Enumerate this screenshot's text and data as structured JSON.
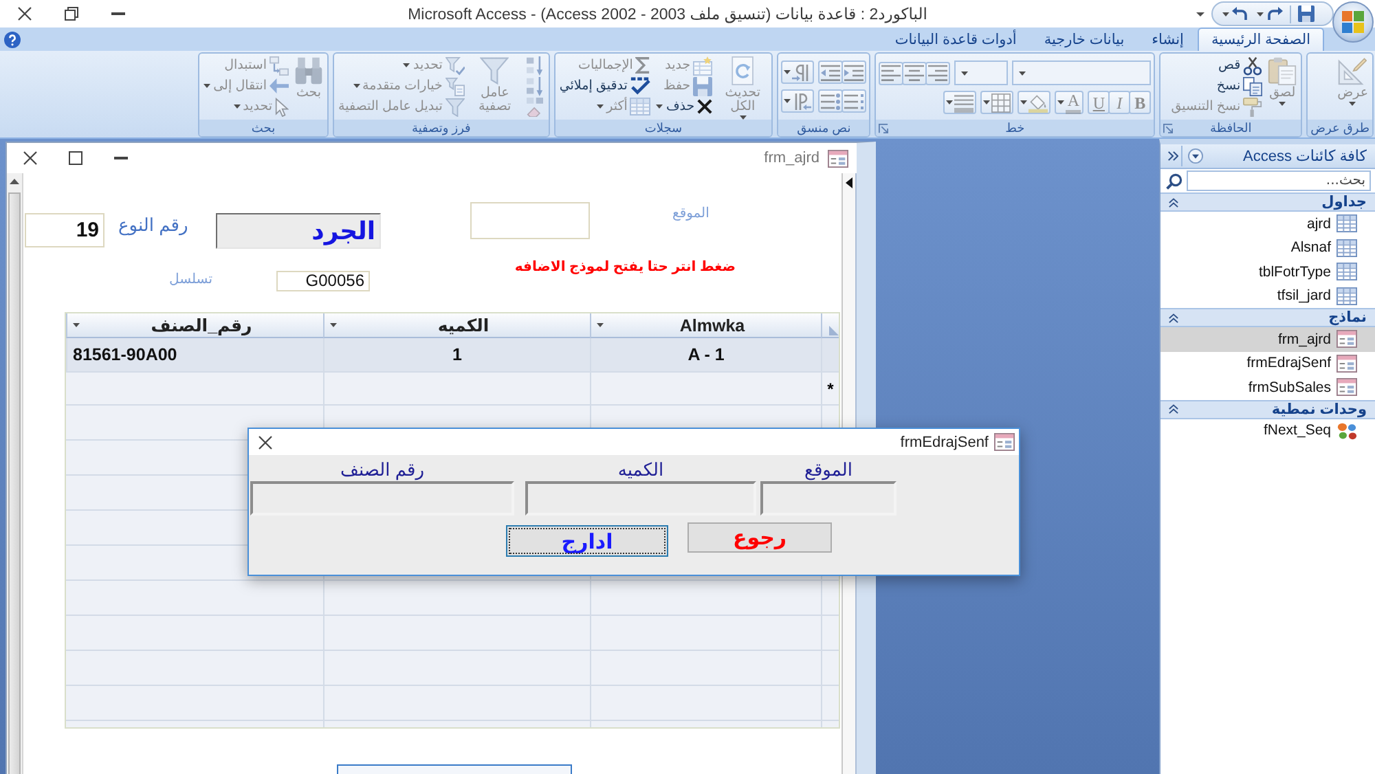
{
  "window": {
    "title": "الباكورد2 : قاعدة بيانات (تنسيق ملف Access 2002 - 2003) - Microsoft Access"
  },
  "ribbon": {
    "tabs": [
      {
        "label": "الصفحة الرئيسية",
        "selected": true
      },
      {
        "label": "إنشاء",
        "selected": false
      },
      {
        "label": "بيانات خارجية",
        "selected": false
      },
      {
        "label": "أدوات قاعدة البيانات",
        "selected": false
      }
    ],
    "groups": [
      {
        "title": "طرق عرض",
        "launcher": false,
        "commands": [
          {
            "kind": "large",
            "label": "عرض",
            "dropdown": true,
            "disabled": true
          }
        ]
      },
      {
        "title": "الحافظة",
        "launcher": true,
        "commands": [
          {
            "kind": "large",
            "label": "لصق",
            "dropdown": true,
            "disabled": true
          },
          {
            "kind": "small",
            "label": "قص",
            "dropdown": false,
            "disabled": false
          },
          {
            "kind": "small",
            "label": "نسخ",
            "dropdown": false,
            "disabled": false
          },
          {
            "kind": "small",
            "label": "نسخ التنسيق",
            "dropdown": false,
            "disabled": true
          }
        ]
      },
      {
        "title": "خط",
        "launcher": true,
        "commands": [
          {
            "kind": "combo",
            "dropdown": true,
            "disabled": true
          },
          {
            "kind": "combo",
            "dropdown": true,
            "disabled": true
          },
          {
            "kind": "icon",
            "dropdown": false,
            "disabled": true
          },
          {
            "kind": "icon",
            "dropdown": false,
            "disabled": true
          },
          {
            "kind": "icon",
            "dropdown": false,
            "disabled": true
          },
          {
            "kind": "letter",
            "label": "B",
            "dropdown": false,
            "disabled": true
          },
          {
            "kind": "letter",
            "label": "I",
            "dropdown": false,
            "disabled": true
          },
          {
            "kind": "letter",
            "label": "U",
            "dropdown": false,
            "disabled": true
          },
          {
            "kind": "letter",
            "label": "A",
            "dropdown": true,
            "disabled": true
          },
          {
            "kind": "icon",
            "dropdown": true,
            "disabled": true
          },
          {
            "kind": "icon",
            "dropdown": true,
            "disabled": true
          },
          {
            "kind": "icon",
            "dropdown": true,
            "disabled": true
          }
        ]
      },
      {
        "title": "نص منسق",
        "launcher": false,
        "commands": [
          {
            "kind": "icon",
            "dropdown": false,
            "disabled": true
          },
          {
            "kind": "icon",
            "dropdown": false,
            "disabled": true
          },
          {
            "kind": "icon",
            "dropdown": true,
            "disabled": true
          },
          {
            "kind": "icon",
            "dropdown": false,
            "disabled": true
          },
          {
            "kind": "icon",
            "dropdown": false,
            "disabled": true
          },
          {
            "kind": "icon",
            "dropdown": true,
            "disabled": true
          }
        ]
      },
      {
        "title": "سجلات",
        "launcher": false,
        "commands": [
          {
            "kind": "large",
            "label": "تحديث الكل",
            "dropdown": true,
            "disabled": true
          },
          {
            "kind": "small",
            "label": "جديد",
            "dropdown": false,
            "disabled": true
          },
          {
            "kind": "small",
            "label": "حفظ",
            "dropdown": false,
            "disabled": true
          },
          {
            "kind": "small",
            "label": "حذف",
            "dropdown": true,
            "disabled": false
          },
          {
            "kind": "small",
            "label": "الإجماليات",
            "dropdown": false,
            "disabled": true
          },
          {
            "kind": "small",
            "label": "تدقيق إملائي",
            "dropdown": false,
            "disabled": false
          },
          {
            "kind": "small",
            "label": "أكثر",
            "dropdown": true,
            "disabled": true
          }
        ]
      },
      {
        "title": "فرز وتصفية",
        "launcher": false,
        "commands": [
          {
            "kind": "icon",
            "dropdown": false,
            "disabled": true
          },
          {
            "kind": "icon",
            "dropdown": false,
            "disabled": true
          },
          {
            "kind": "icon",
            "dropdown": false,
            "disabled": true
          },
          {
            "kind": "large",
            "label": "عامل تصفية",
            "dropdown": false,
            "disabled": true
          },
          {
            "kind": "small",
            "label": "تحديد",
            "dropdown": true,
            "disabled": true
          },
          {
            "kind": "small",
            "label": "خيارات متقدمة",
            "dropdown": true,
            "disabled": true
          },
          {
            "kind": "small",
            "label": "تبديل عامل التصفية",
            "dropdown": false,
            "disabled": true
          }
        ]
      },
      {
        "title": "بحث",
        "launcher": false,
        "commands": [
          {
            "kind": "large",
            "label": "بحث",
            "dropdown": false,
            "disabled": true
          },
          {
            "kind": "small",
            "label": "استبدال",
            "dropdown": false,
            "disabled": true
          },
          {
            "kind": "small",
            "label": "انتقال إلى",
            "dropdown": true,
            "disabled": true
          },
          {
            "kind": "small",
            "label": "تحديد",
            "dropdown": true,
            "disabled": true
          }
        ]
      }
    ]
  },
  "form_window": {
    "title": "frm_ajrd",
    "fields": [
      {
        "kind": "textbox",
        "label": "الموقع"
      },
      {
        "kind": "sunken",
        "value": "الجرد"
      },
      {
        "kind": "textbox",
        "label": "رقم النوع",
        "value": "19"
      },
      {
        "kind": "textbox",
        "label": "تسلسل",
        "value": "G00056"
      }
    ],
    "note": "ضغط انتر حتا يفتح لموذج الاضافه",
    "datasheet": {
      "columns": [
        "Almwka",
        "الكميه",
        "رقم_الصنف"
      ],
      "rows": [
        {
          "cells": [
            "A - 1",
            "1",
            "81561-90A00"
          ],
          "selected": true
        }
      ],
      "new_row": {
        "marker": "*"
      }
    }
  },
  "dialog": {
    "title": "frmEdrajSenf",
    "fields": [
      {
        "label": "الموقع"
      },
      {
        "label": "الكميه"
      },
      {
        "label": "رقم الصنف"
      }
    ],
    "buttons": [
      {
        "label": "رجوع",
        "color": "#ff0000",
        "focused": false
      },
      {
        "label": "ادارج",
        "color": "#1a1aff",
        "focused": true
      }
    ]
  },
  "navigation_pane": {
    "title": "كافة كائنات Access",
    "search": {
      "placeholder": "بحث..."
    },
    "groups": [
      {
        "title": "جداول",
        "expanded": true,
        "items": [
          {
            "label": "ajrd",
            "selected": false
          },
          {
            "label": "Alsnaf",
            "selected": false
          },
          {
            "label": "tblFotrType",
            "selected": false
          },
          {
            "label": "tfsil_jard",
            "selected": false
          }
        ]
      },
      {
        "title": "نماذج",
        "expanded": true,
        "items": [
          {
            "label": "frm_ajrd",
            "selected": true
          },
          {
            "label": "frmEdrajSenf",
            "selected": false
          },
          {
            "label": "frmSubSales",
            "selected": false
          }
        ]
      },
      {
        "title": "وحدات نمطية",
        "expanded": true,
        "items": [
          {
            "label": "fNext_Seq",
            "selected": false
          }
        ]
      }
    ]
  }
}
